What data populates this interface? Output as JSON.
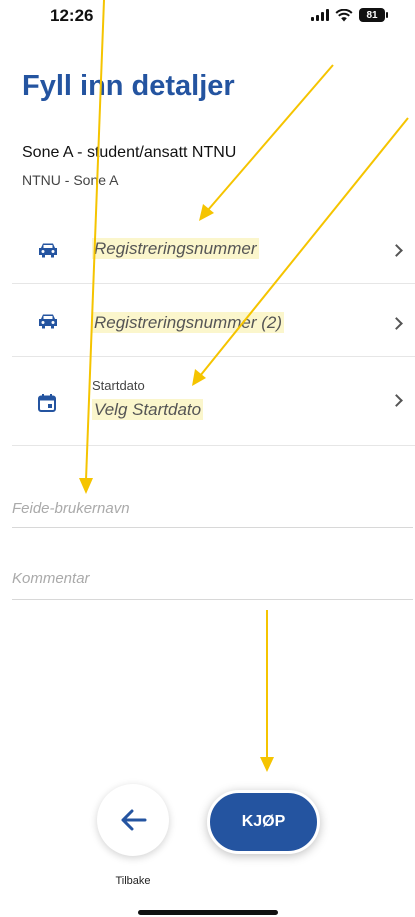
{
  "status_bar": {
    "time": "12:26",
    "battery": "81"
  },
  "page": {
    "title": "Fyll inn detaljer"
  },
  "product": {
    "name": "Sone A - student/ansatt NTNU",
    "subtitle": "NTNU - Sone A"
  },
  "rows": [
    {
      "icon": "car-icon",
      "placeholder": "Registreringsnummer"
    },
    {
      "icon": "car-icon",
      "placeholder": "Registreringsnummer (2)"
    },
    {
      "icon": "calendar-icon",
      "label": "Startdato",
      "placeholder": "Velg Startdato"
    }
  ],
  "fields": [
    {
      "placeholder": "Feide-brukernavn"
    },
    {
      "placeholder": "Kommentar"
    }
  ],
  "footer": {
    "back_label": "Tilbake",
    "buy_label": "KJØP"
  },
  "colors": {
    "primary": "#2454a0",
    "highlight": "#fbf6cc",
    "annotation_arrow": "#f5c400"
  }
}
